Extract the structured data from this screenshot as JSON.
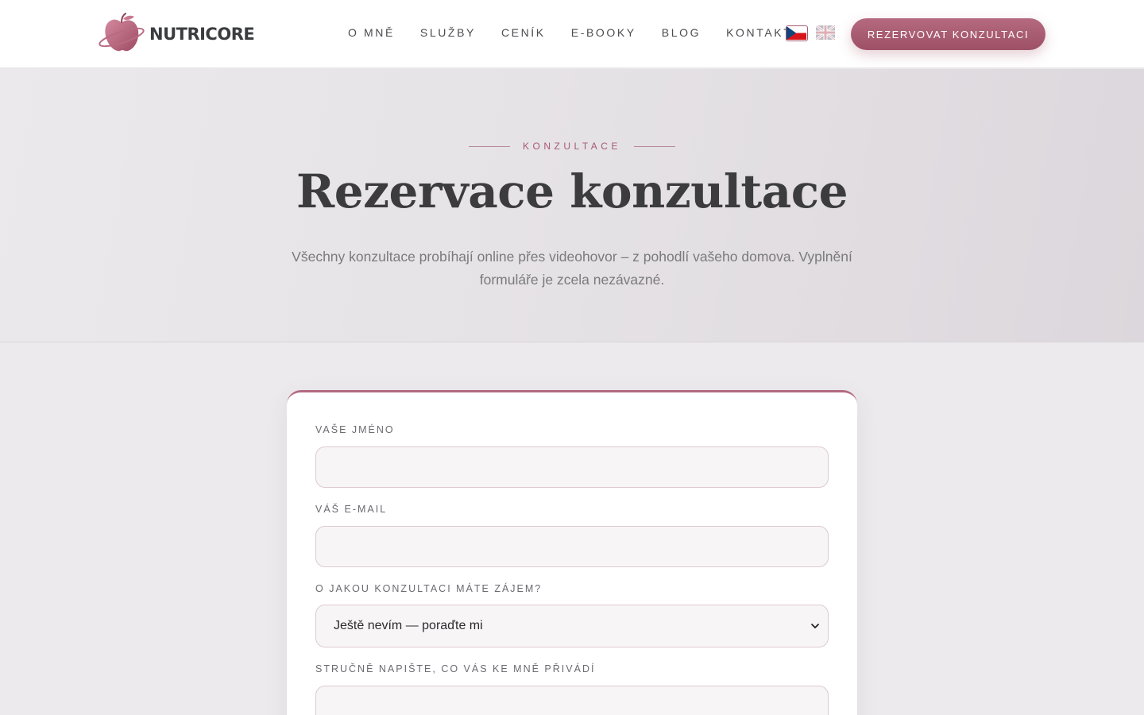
{
  "brand": {
    "name": "NUTRICORE"
  },
  "nav": {
    "items": [
      {
        "label": "O MNĚ"
      },
      {
        "label": "SLUŽBY"
      },
      {
        "label": "CENÍK"
      },
      {
        "label": "E-BOOKY"
      },
      {
        "label": "BLOG"
      },
      {
        "label": "KONTAKT"
      }
    ],
    "languages": [
      "cz-flag-icon",
      "uk-flag-icon"
    ],
    "cta_label": "REZERVOVAT KONZULTACI"
  },
  "hero": {
    "eyebrow": "KONZULTACE",
    "title": "Rezervace konzultace",
    "subtitle": "Všechny konzultace probíhají online přes videohovor – z pohodlí vašeho domova. Vyplnění formuláře je zcela nezávazné."
  },
  "form": {
    "name_label": "VAŠE JMÉNO",
    "name_value": "",
    "email_label": "VÁŠ E-MAIL",
    "email_value": "",
    "consult_label": "O JAKOU KONZULTACI MÁTE ZÁJEM?",
    "consult_selected": "Ještě nevím — poraďte mi",
    "message_label": "STRUČNĚ NAPIŠTE, CO VÁS KE MNĚ PŘIVÁDÍ"
  },
  "colors": {
    "accent": "#a85a70",
    "hero_bg": "#e6e3e6",
    "page_bg": "#eceaed"
  }
}
